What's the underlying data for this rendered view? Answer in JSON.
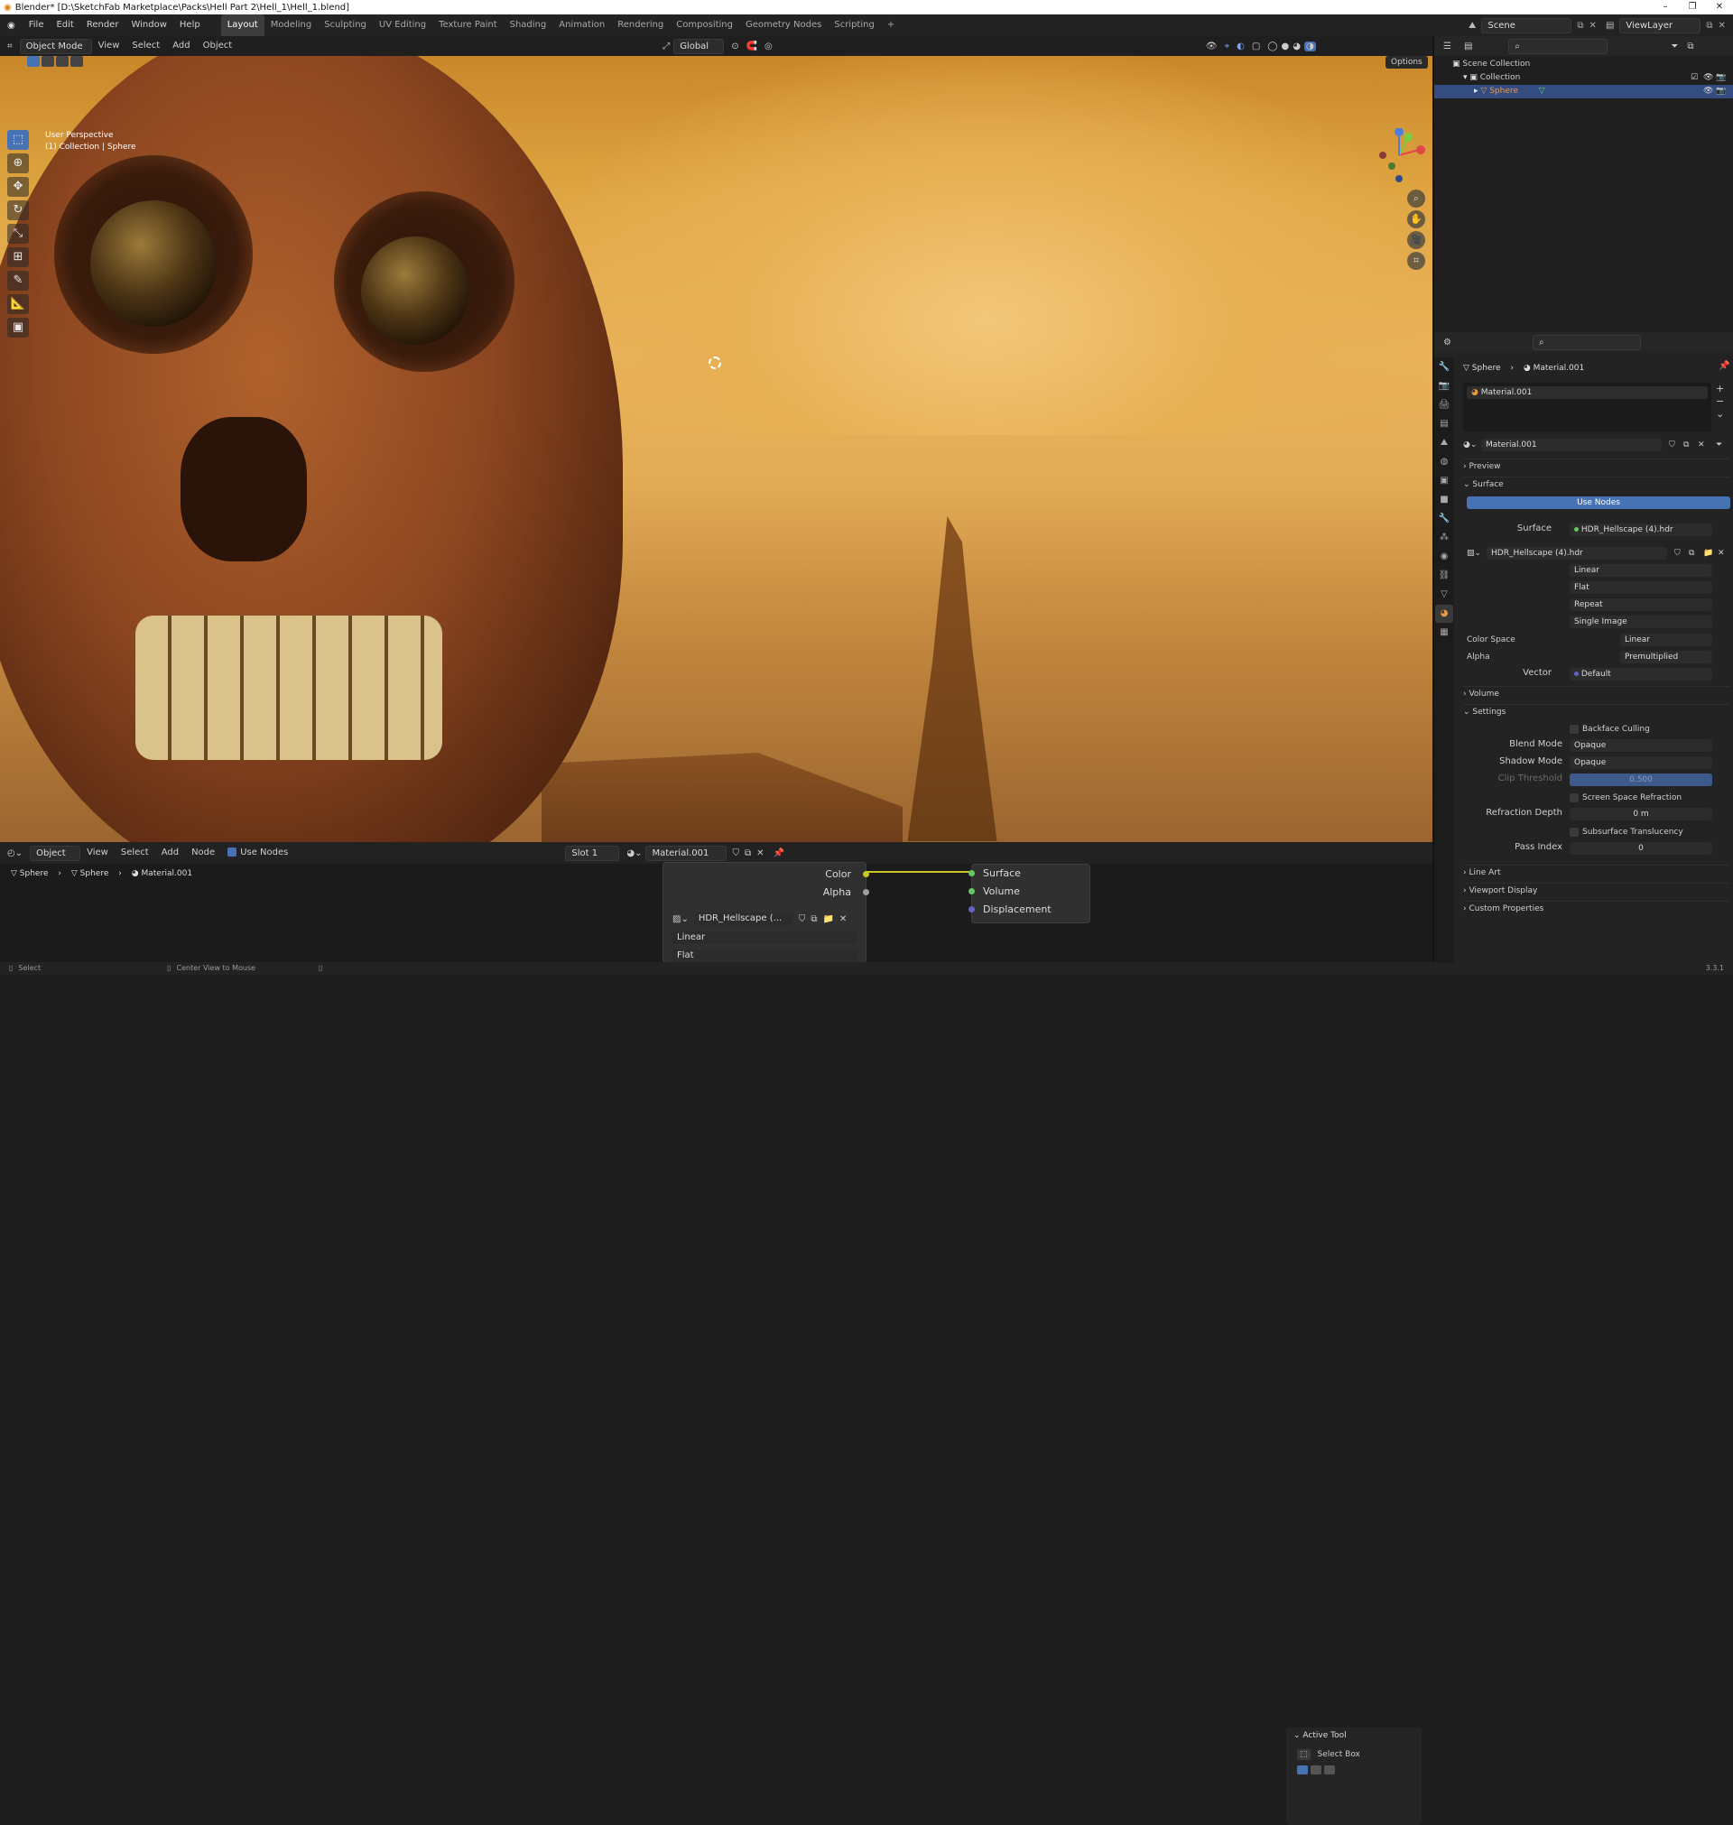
{
  "window": {
    "title": "Blender* [D:\\SketchFab Marketplace\\Packs\\Hell Part 2\\Hell_1\\Hell_1.blend]",
    "controls": [
      "–",
      "❐",
      "✕"
    ]
  },
  "menu": {
    "items": [
      "File",
      "Edit",
      "Render",
      "Window",
      "Help"
    ],
    "workspaces": [
      "Layout",
      "Modeling",
      "Sculpting",
      "UV Editing",
      "Texture Paint",
      "Shading",
      "Animation",
      "Rendering",
      "Compositing",
      "Geometry Nodes",
      "Scripting"
    ],
    "active_workspace": "Layout",
    "add_tab": "+"
  },
  "scene_header": {
    "scene_label": "Scene",
    "view_layer_label": "ViewLayer"
  },
  "viewport": {
    "mode": "Object Mode",
    "menus": [
      "View",
      "Select",
      "Add",
      "Object"
    ],
    "transform_orientation": "Global",
    "options_label": "Options",
    "info_line1": "User Perspective",
    "info_line2": "(1) Collection | Sphere",
    "gizmo_axes": {
      "x": "X",
      "y": "Y",
      "z": "Z"
    }
  },
  "tools": [
    {
      "name": "select-box-tool",
      "glyph": "⬚",
      "active": true
    },
    {
      "name": "cursor-tool",
      "glyph": "⊕",
      "active": false
    },
    {
      "name": "move-tool",
      "glyph": "✥",
      "active": false
    },
    {
      "name": "rotate-tool",
      "glyph": "↻",
      "active": false
    },
    {
      "name": "scale-tool",
      "glyph": "⤡",
      "active": false
    },
    {
      "name": "transform-tool",
      "glyph": "⊞",
      "active": false
    },
    {
      "name": "annotate-tool",
      "glyph": "✎",
      "active": false
    },
    {
      "name": "measure-tool",
      "glyph": "📐",
      "active": false
    },
    {
      "name": "add-cube-tool",
      "glyph": "▣",
      "active": false
    }
  ],
  "outliner": {
    "rows": [
      {
        "label": "Scene Collection",
        "indent": 0,
        "selected": false
      },
      {
        "label": "Collection",
        "indent": 1,
        "selected": false
      },
      {
        "label": "Sphere",
        "indent": 2,
        "selected": true
      }
    ]
  },
  "properties": {
    "breadcrumb_object": "Sphere",
    "breadcrumb_material": "Material.001",
    "slot_name": "Material.001",
    "material_name": "Material.001",
    "sections": {
      "preview": "Preview",
      "surface": "Surface",
      "volume": "Volume",
      "settings": "Settings",
      "line_art": "Line Art",
      "viewport_display": "Viewport Display",
      "custom_properties": "Custom Properties"
    },
    "use_nodes": "Use Nodes",
    "surface_label": "Surface",
    "surface_value": "HDR_Hellscape (4).hdr",
    "image_name": "HDR_Hellscape (4).hdr",
    "interpolation": "Linear",
    "projection": "Flat",
    "extension": "Repeat",
    "source": "Single Image",
    "color_space_label": "Color Space",
    "color_space_value": "Linear",
    "alpha_label": "Alpha",
    "alpha_value": "Premultiplied",
    "vector_label": "Vector",
    "vector_value": "Default",
    "backface_culling": "Backface Culling",
    "blend_mode_label": "Blend Mode",
    "blend_mode_value": "Opaque",
    "shadow_mode_label": "Shadow Mode",
    "shadow_mode_value": "Opaque",
    "clip_threshold_label": "Clip Threshold",
    "clip_threshold_value": "0.500",
    "ssr": "Screen Space Refraction",
    "refraction_depth_label": "Refraction Depth",
    "refraction_depth_value": "0 m",
    "subsurface": "Subsurface Translucency",
    "pass_index_label": "Pass Index",
    "pass_index_value": "0"
  },
  "node_editor": {
    "type": "Object",
    "menus": [
      "View",
      "Select",
      "Add",
      "Node"
    ],
    "use_nodes": "Use Nodes",
    "slot": "Slot 1",
    "material": "Material.001",
    "breadcrumb": [
      "Sphere",
      "Sphere",
      "Material.001"
    ],
    "image_node": {
      "outputs": [
        "Color",
        "Alpha"
      ],
      "image": "HDR_Hellscape (...",
      "interpolation": "Linear",
      "projection": "Flat"
    },
    "output_node": {
      "inputs": [
        "Surface",
        "Volume",
        "Displacement"
      ]
    },
    "n_panel": {
      "title": "Active Tool",
      "tool": "Select Box"
    }
  },
  "status": {
    "left": "Select",
    "middle": "Center View to Mouse",
    "version": "3.3.1"
  },
  "colors": {
    "accent": "#4772b3",
    "selected_row": "#334d80",
    "socket_yellow": "#c7c729",
    "socket_green": "#63c763",
    "socket_purple": "#6363c7"
  }
}
